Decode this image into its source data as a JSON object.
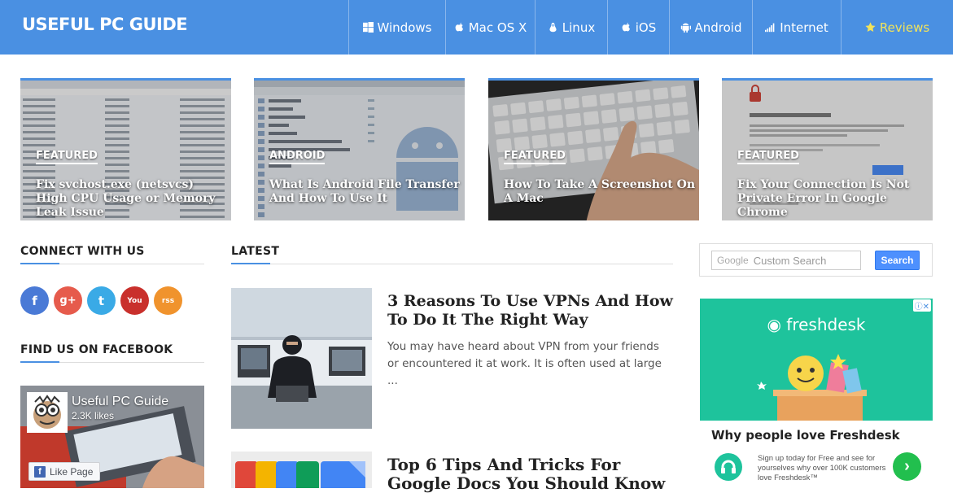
{
  "site": {
    "logo": "USEFUL PC GUIDE"
  },
  "nav": [
    {
      "label": "Windows",
      "icon": "windows-icon"
    },
    {
      "label": "Mac OS X",
      "icon": "apple-icon"
    },
    {
      "label": "Linux",
      "icon": "linux-icon"
    },
    {
      "label": "iOS",
      "icon": "apple-icon"
    },
    {
      "label": "Android",
      "icon": "android-icon"
    },
    {
      "label": "Internet",
      "icon": "signal-icon"
    },
    {
      "label": "Reviews",
      "icon": "star-icon",
      "color": "#f2e35a"
    }
  ],
  "featured": [
    {
      "category": "FEATURED",
      "title": "Fix svchost.exe (netsvcs) High CPU Usage or Memory Leak Issue"
    },
    {
      "category": "ANDROID",
      "title": "What Is Android File Transfer And How To Use It"
    },
    {
      "category": "FEATURED",
      "title": "How To Take A Screenshot On A Mac"
    },
    {
      "category": "FEATURED",
      "title": "Fix Your Connection Is Not Private Error In Google Chrome"
    }
  ],
  "sidebar_left": {
    "connect_heading": "CONNECT WITH US",
    "social": [
      {
        "name": "facebook",
        "glyph": "f",
        "color": "#4a7ad6"
      },
      {
        "name": "google-plus",
        "glyph": "g+",
        "color": "#e65b4c"
      },
      {
        "name": "twitter",
        "glyph": "t",
        "color": "#3aaae6"
      },
      {
        "name": "youtube",
        "glyph": "You",
        "color": "#c9302c"
      },
      {
        "name": "rss",
        "glyph": "rss",
        "color": "#f0932d"
      }
    ],
    "facebook_heading": "FIND US ON FACEBOOK",
    "fb_widget": {
      "page_name": "Useful PC Guide",
      "likes": "2.3K likes",
      "like_button": "Like Page"
    }
  },
  "latest": {
    "heading": "LATEST",
    "posts": [
      {
        "title": "3 Reasons To Use VPNs And How To Do It The Right Way",
        "excerpt": "You may have heard about VPN from your friends or encountered it at work. It is often used at large ..."
      },
      {
        "title": "Top 6 Tips And Tricks For Google Docs You Should Know",
        "excerpt": ""
      }
    ]
  },
  "search": {
    "placeholder": "Custom Search",
    "brand": "Google",
    "button": "Search"
  },
  "ad": {
    "brand": "freshdesk",
    "headline": "Why people love Freshdesk",
    "text": "Sign up today for Free and see for yourselves why over 100K customers love Freshdesk™",
    "accent": "#1ec39c"
  },
  "colors": {
    "header": "#4a90e2"
  }
}
